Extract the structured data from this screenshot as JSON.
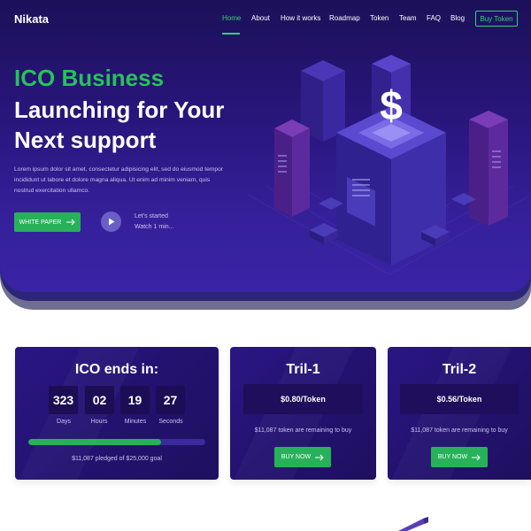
{
  "brand": {
    "logo": "Nikata"
  },
  "nav": {
    "items": [
      {
        "label": "Home",
        "active": true
      },
      {
        "label": "About"
      },
      {
        "label": "How it works"
      },
      {
        "label": "Roadmap"
      },
      {
        "label": "Token"
      },
      {
        "label": "Team"
      },
      {
        "label": "FAQ"
      },
      {
        "label": "Blog"
      }
    ],
    "cta": "Buy Token"
  },
  "hero": {
    "title_green": "ICO Business",
    "title_line1": "Launching for Your",
    "title_line2": "Next support",
    "description": "Lorem ipsum dolor sit amet, consectetur adipisicing elit, sed do eiusmod tempor incididunt ut labore et dolore magna aliqua. Ut enim ad minim veniam, quis nostrud exercitation ullamco.",
    "whitepaper_label": "WHITE PAPER",
    "watch_line1": "Let's started",
    "watch_line2": "Watch 1 min...",
    "illustration_symbol": "$"
  },
  "ico_card": {
    "title": "ICO ends in:",
    "countdown": [
      {
        "value": "323",
        "label": "Days"
      },
      {
        "value": "02",
        "label": "Hours"
      },
      {
        "value": "19",
        "label": "Minutes"
      },
      {
        "value": "27",
        "label": "Seconds"
      }
    ],
    "progress_fraction": 0.75,
    "pledged_text": "$11,087 pledged of $25,000 goal"
  },
  "tril_cards": [
    {
      "title": "Tril-1",
      "price": "$0.80/Token",
      "remaining": "$11,087 token are remaining to buy",
      "button": "BUY NOW"
    },
    {
      "title": "Tril-2",
      "price": "$0.56/Token",
      "remaining": "$11,087 token are remaining to buy",
      "button": "BUY NOW"
    }
  ],
  "colors": {
    "accent_green": "#27b25a",
    "hero_bg": "#2a1780",
    "card_bg": "#241270"
  }
}
